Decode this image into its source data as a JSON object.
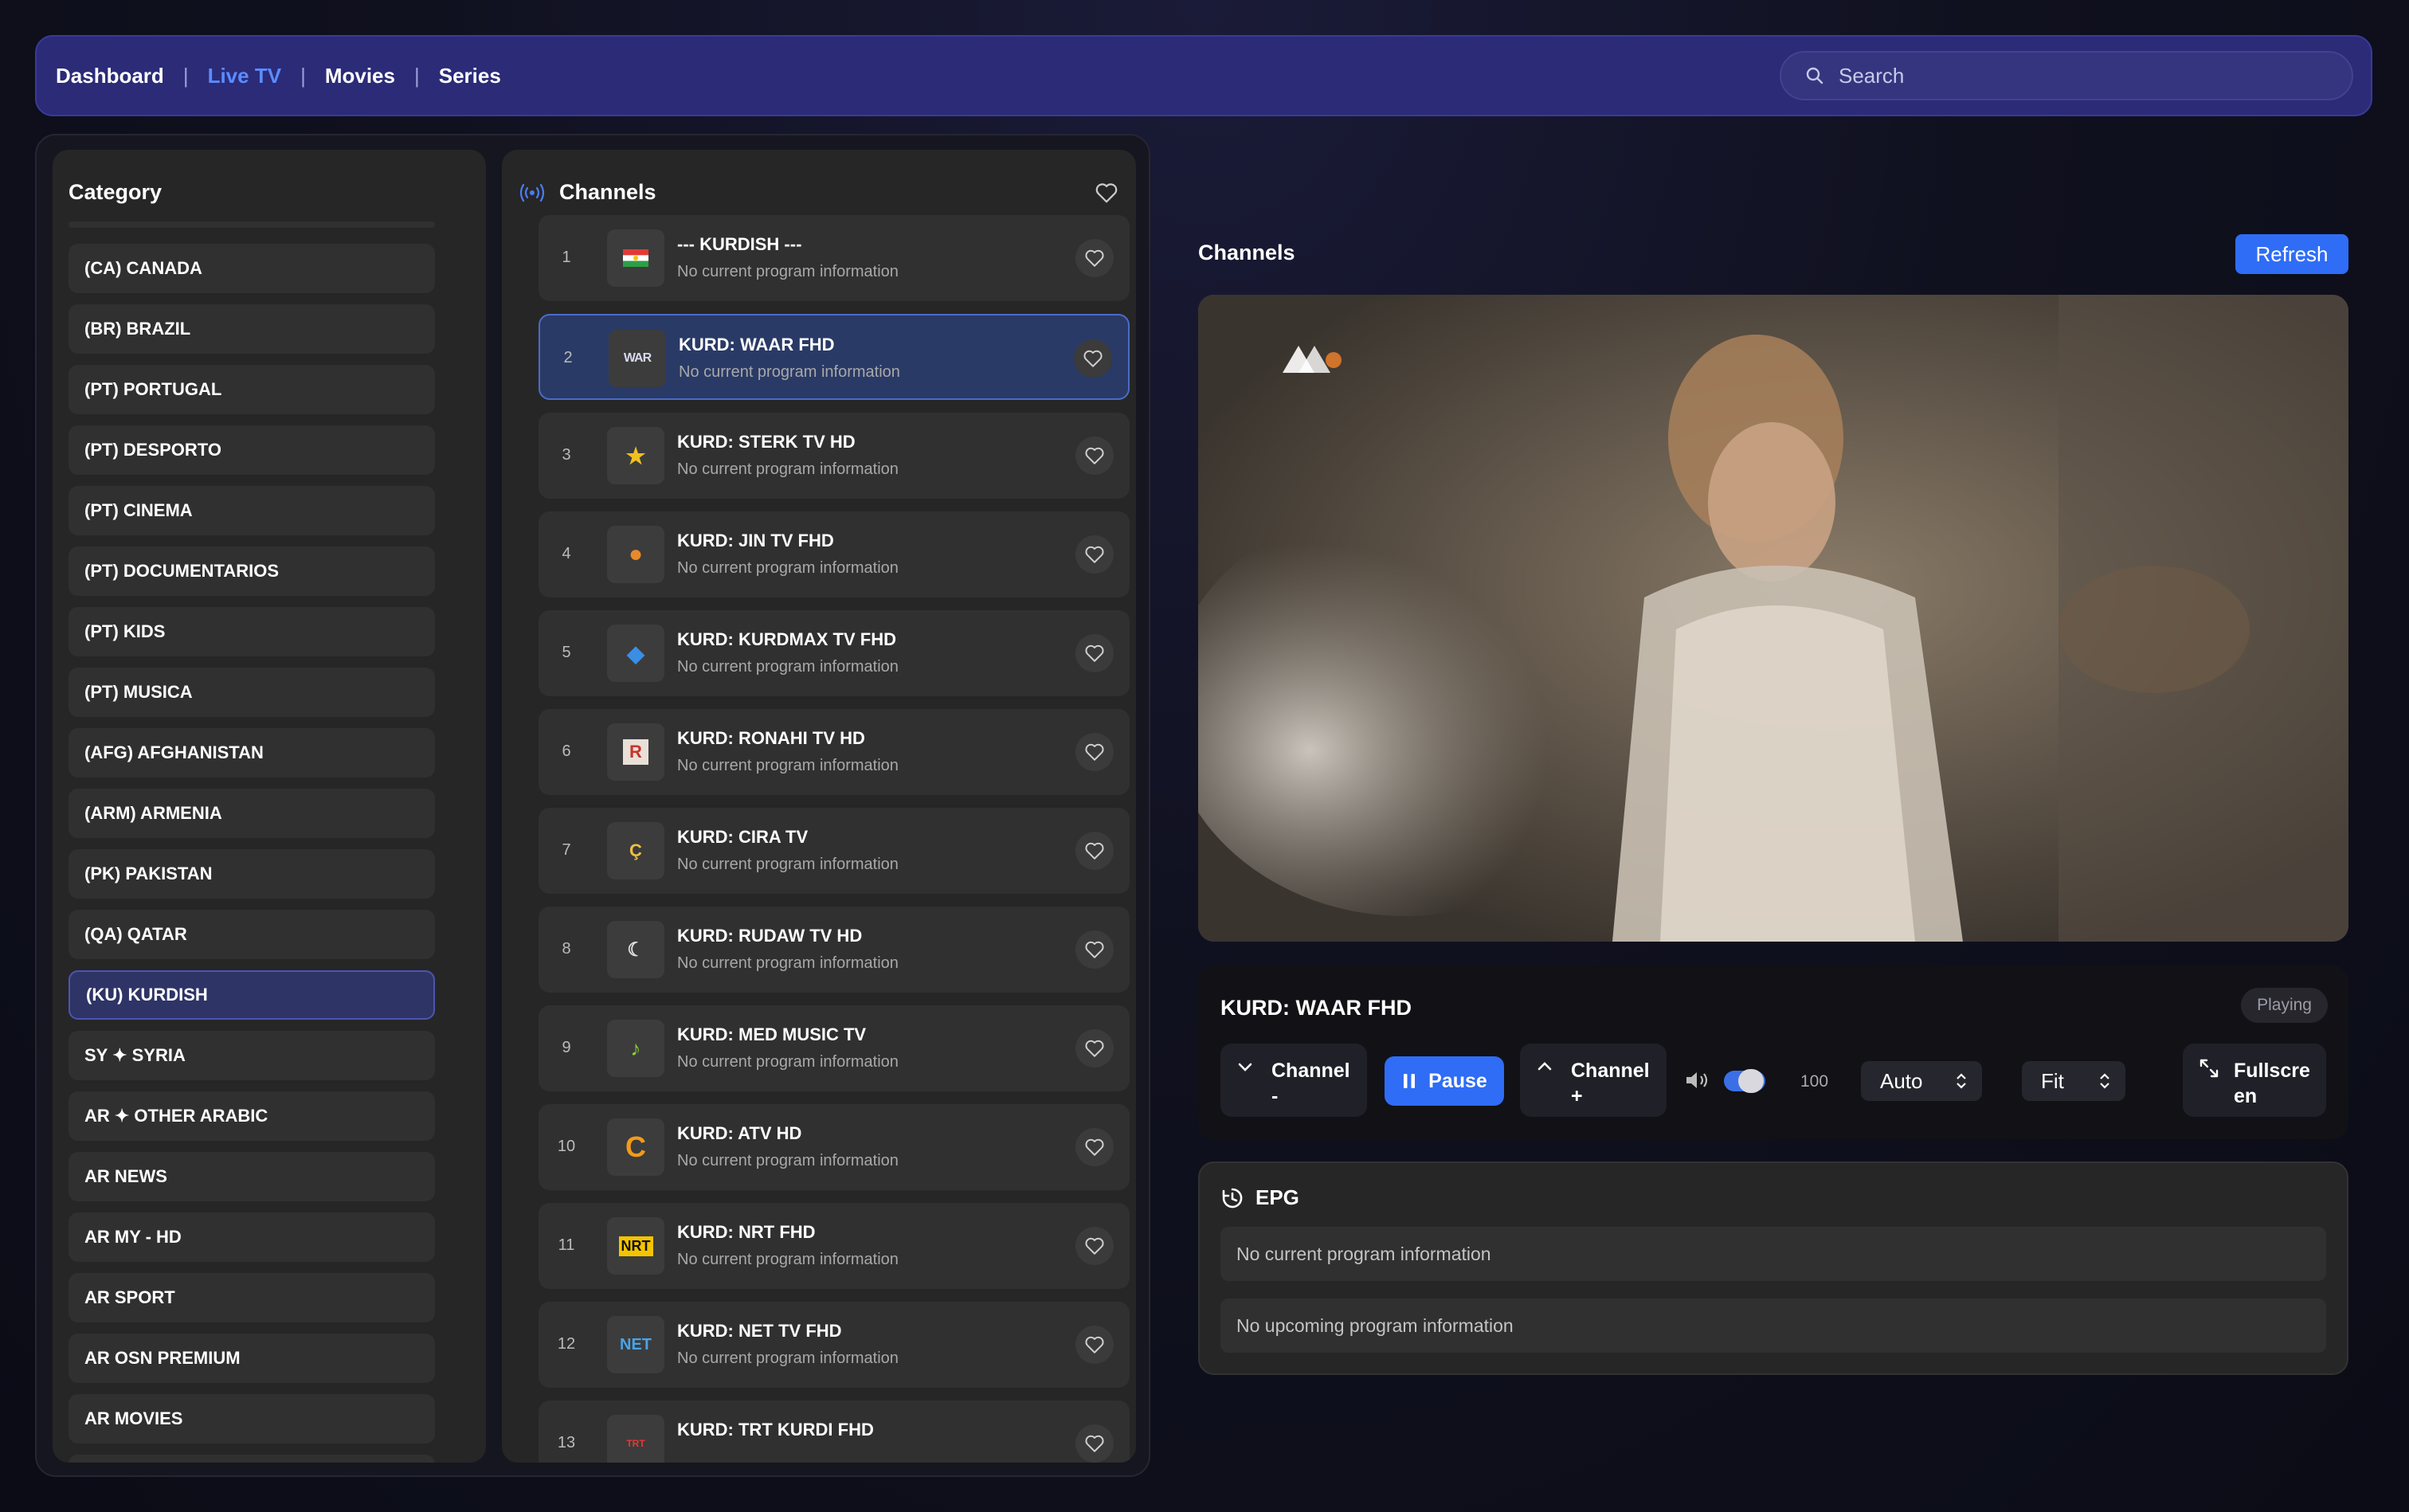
{
  "nav": {
    "items": [
      {
        "label": "Dashboard",
        "active": false
      },
      {
        "label": "Live TV",
        "active": true
      },
      {
        "label": "Movies",
        "active": false
      },
      {
        "label": "Series",
        "active": false
      }
    ],
    "separator": "|",
    "search_placeholder": "Search"
  },
  "categories": {
    "title": "Category",
    "items": [
      "(CA) CANADA",
      "(BR) BRAZIL",
      "(PT) PORTUGAL",
      "(PT) DESPORTO",
      "(PT) CINEMA",
      "(PT) DOCUMENTARIOS",
      "(PT) KIDS",
      "(PT) MUSICA",
      "(AFG) AFGHANISTAN",
      "(ARM) ARMENIA",
      "(PK) PAKISTAN",
      "(QA) QATAR",
      "(KU) KURDISH",
      "SY ✦ SYRIA",
      "AR ✦ OTHER ARABIC",
      "AR NEWS",
      "AR MY - HD",
      "AR SPORT",
      "AR OSN PREMIUM",
      "AR MOVIES"
    ],
    "active": "(KU) KURDISH"
  },
  "channels": {
    "title": "Channels",
    "items": [
      {
        "num": "1",
        "name": "--- KURDISH ---",
        "info": "No current program information",
        "logo": "flag"
      },
      {
        "num": "2",
        "name": "KURD: WAAR FHD",
        "info": "No current program information",
        "logo": "WAR"
      },
      {
        "num": "3",
        "name": "KURD: STERK TV HD",
        "info": "No current program information",
        "logo": "★"
      },
      {
        "num": "4",
        "name": "KURD: JIN TV FHD",
        "info": "No current program information",
        "logo": "●"
      },
      {
        "num": "5",
        "name": "KURD: KURDMAX TV FHD",
        "info": "No current program information",
        "logo": "◆"
      },
      {
        "num": "6",
        "name": "KURD: RONAHI TV HD",
        "info": "No current program information",
        "logo": "R"
      },
      {
        "num": "7",
        "name": "KURD: CIRA TV",
        "info": "No current program information",
        "logo": "Ç"
      },
      {
        "num": "8",
        "name": "KURD: RUDAW TV HD",
        "info": "No current program information",
        "logo": "☾"
      },
      {
        "num": "9",
        "name": "KURD: MED MUSIC TV",
        "info": "No current program information",
        "logo": "♪"
      },
      {
        "num": "10",
        "name": "KURD: ATV HD",
        "info": "No current program information",
        "logo": "C"
      },
      {
        "num": "11",
        "name": "KURD: NRT FHD",
        "info": "No current program information",
        "logo": "NRT"
      },
      {
        "num": "12",
        "name": "KURD: NET TV FHD",
        "info": "No current program information",
        "logo": "NET"
      },
      {
        "num": "13",
        "name": "KURD: TRT KURDI FHD",
        "info": "",
        "logo": "TRT"
      }
    ],
    "active_index": 1
  },
  "player": {
    "section_title": "Channels",
    "refresh_label": "Refresh",
    "now_playing": "KURD: WAAR FHD",
    "status": "Playing",
    "channel_down_label": "Channel",
    "channel_down_suffix": "-",
    "pause_label": "Pause",
    "channel_up_label": "Channel",
    "channel_up_suffix": "+",
    "volume": "100",
    "quality": "Auto",
    "aspect": "Fit",
    "fullscreen_label_1": "Fullscre",
    "fullscreen_label_2": "en"
  },
  "epg": {
    "title": "EPG",
    "current": "No current program information",
    "upcoming": "No upcoming program information"
  },
  "colors": {
    "accent": "#2f6df6",
    "nav_bg": "#2b2b78",
    "active_link": "#5b8cff"
  }
}
